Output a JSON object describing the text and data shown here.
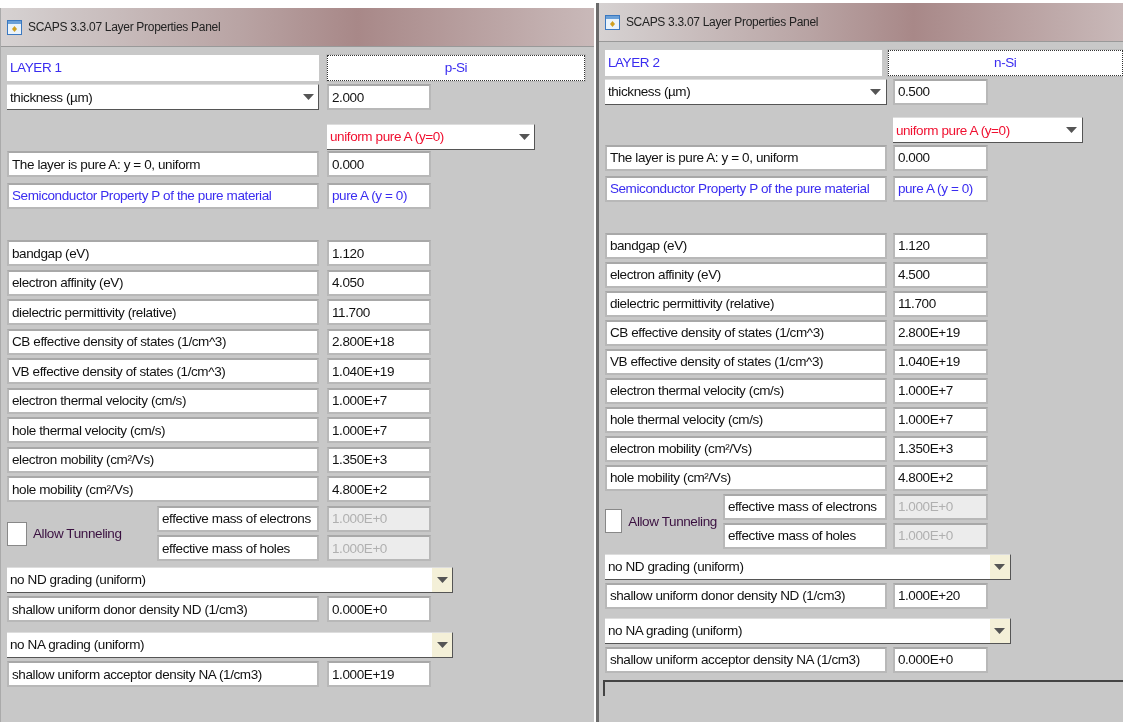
{
  "panels": [
    {
      "window": {
        "title": "SCAPS 3.3.07 Layer Properties Panel"
      },
      "layer_name": "LAYER 1",
      "material": "p-Si",
      "thickness": {
        "label": "thickness (µm)",
        "value": "2.000"
      },
      "composition": {
        "grading": "uniform pure A (y=0)",
        "label": "The layer is pure A: y = 0, uniform",
        "value": "0.000"
      },
      "semiconductor": {
        "label": "Semiconductor Property P of the pure material",
        "value": "pure A (y = 0)"
      },
      "properties": [
        {
          "label": "bandgap (eV)",
          "value": "1.120"
        },
        {
          "label": "electron affinity (eV)",
          "value": "4.050"
        },
        {
          "label": "dielectric permittivity (relative)",
          "value": "11.700"
        },
        {
          "label": "CB effective density of states (1/cm^3)",
          "value": "2.800E+18"
        },
        {
          "label": "VB effective density of states (1/cm^3)",
          "value": "1.040E+19"
        },
        {
          "label": "electron thermal velocity (cm/s)",
          "value": "1.000E+7"
        },
        {
          "label": "hole thermal velocity (cm/s)",
          "value": "1.000E+7"
        },
        {
          "label": "electron mobility (cm²/Vs)",
          "value": "1.350E+3"
        },
        {
          "label": "hole mobility (cm²/Vs)",
          "value": "4.800E+2"
        }
      ],
      "tunneling": {
        "label": "Allow Tunneling",
        "checked": false,
        "masses": [
          {
            "label": "effective mass of electrons",
            "value": "1.000E+0",
            "disabled": true
          },
          {
            "label": "effective mass of holes",
            "value": "1.000E+0",
            "disabled": true
          }
        ]
      },
      "doping": [
        {
          "grading": "no ND grading (uniform)",
          "label": "shallow uniform donor density ND (1/cm3)",
          "value": "0.000E+0"
        },
        {
          "grading": "no NA grading (uniform)",
          "label": "shallow uniform acceptor density NA (1/cm3)",
          "value": "1.000E+19"
        }
      ]
    },
    {
      "window": {
        "title": "SCAPS 3.3.07 Layer Properties Panel"
      },
      "layer_name": "LAYER 2",
      "material": "n-Si",
      "thickness": {
        "label": "thickness (µm)",
        "value": "0.500"
      },
      "composition": {
        "grading": "uniform pure A (y=0)",
        "label": "The layer is pure A: y = 0, uniform",
        "value": "0.000"
      },
      "semiconductor": {
        "label": "Semiconductor Property P of the pure material",
        "value": "pure A (y = 0)"
      },
      "properties": [
        {
          "label": "bandgap (eV)",
          "value": "1.120"
        },
        {
          "label": "electron affinity (eV)",
          "value": "4.500"
        },
        {
          "label": "dielectric permittivity (relative)",
          "value": "11.700"
        },
        {
          "label": "CB effective density of states (1/cm^3)",
          "value": "2.800E+19"
        },
        {
          "label": "VB effective density of states (1/cm^3)",
          "value": "1.040E+19"
        },
        {
          "label": "electron thermal velocity (cm/s)",
          "value": "1.000E+7"
        },
        {
          "label": "hole thermal velocity (cm/s)",
          "value": "1.000E+7"
        },
        {
          "label": "electron mobility (cm²/Vs)",
          "value": "1.350E+3"
        },
        {
          "label": "hole mobility (cm²/Vs)",
          "value": "4.800E+2"
        }
      ],
      "tunneling": {
        "label": "Allow Tunneling",
        "checked": false,
        "masses": [
          {
            "label": "effective mass of electrons",
            "value": "1.000E+0",
            "disabled": true
          },
          {
            "label": "effective mass of holes",
            "value": "1.000E+0",
            "disabled": true
          }
        ]
      },
      "doping": [
        {
          "grading": "no ND grading (uniform)",
          "label": "shallow uniform donor density ND (1/cm3)",
          "value": "1.000E+20"
        },
        {
          "grading": "no NA grading (uniform)",
          "label": "shallow uniform acceptor density NA (1/cm3)",
          "value": "0.000E+0"
        }
      ]
    }
  ]
}
